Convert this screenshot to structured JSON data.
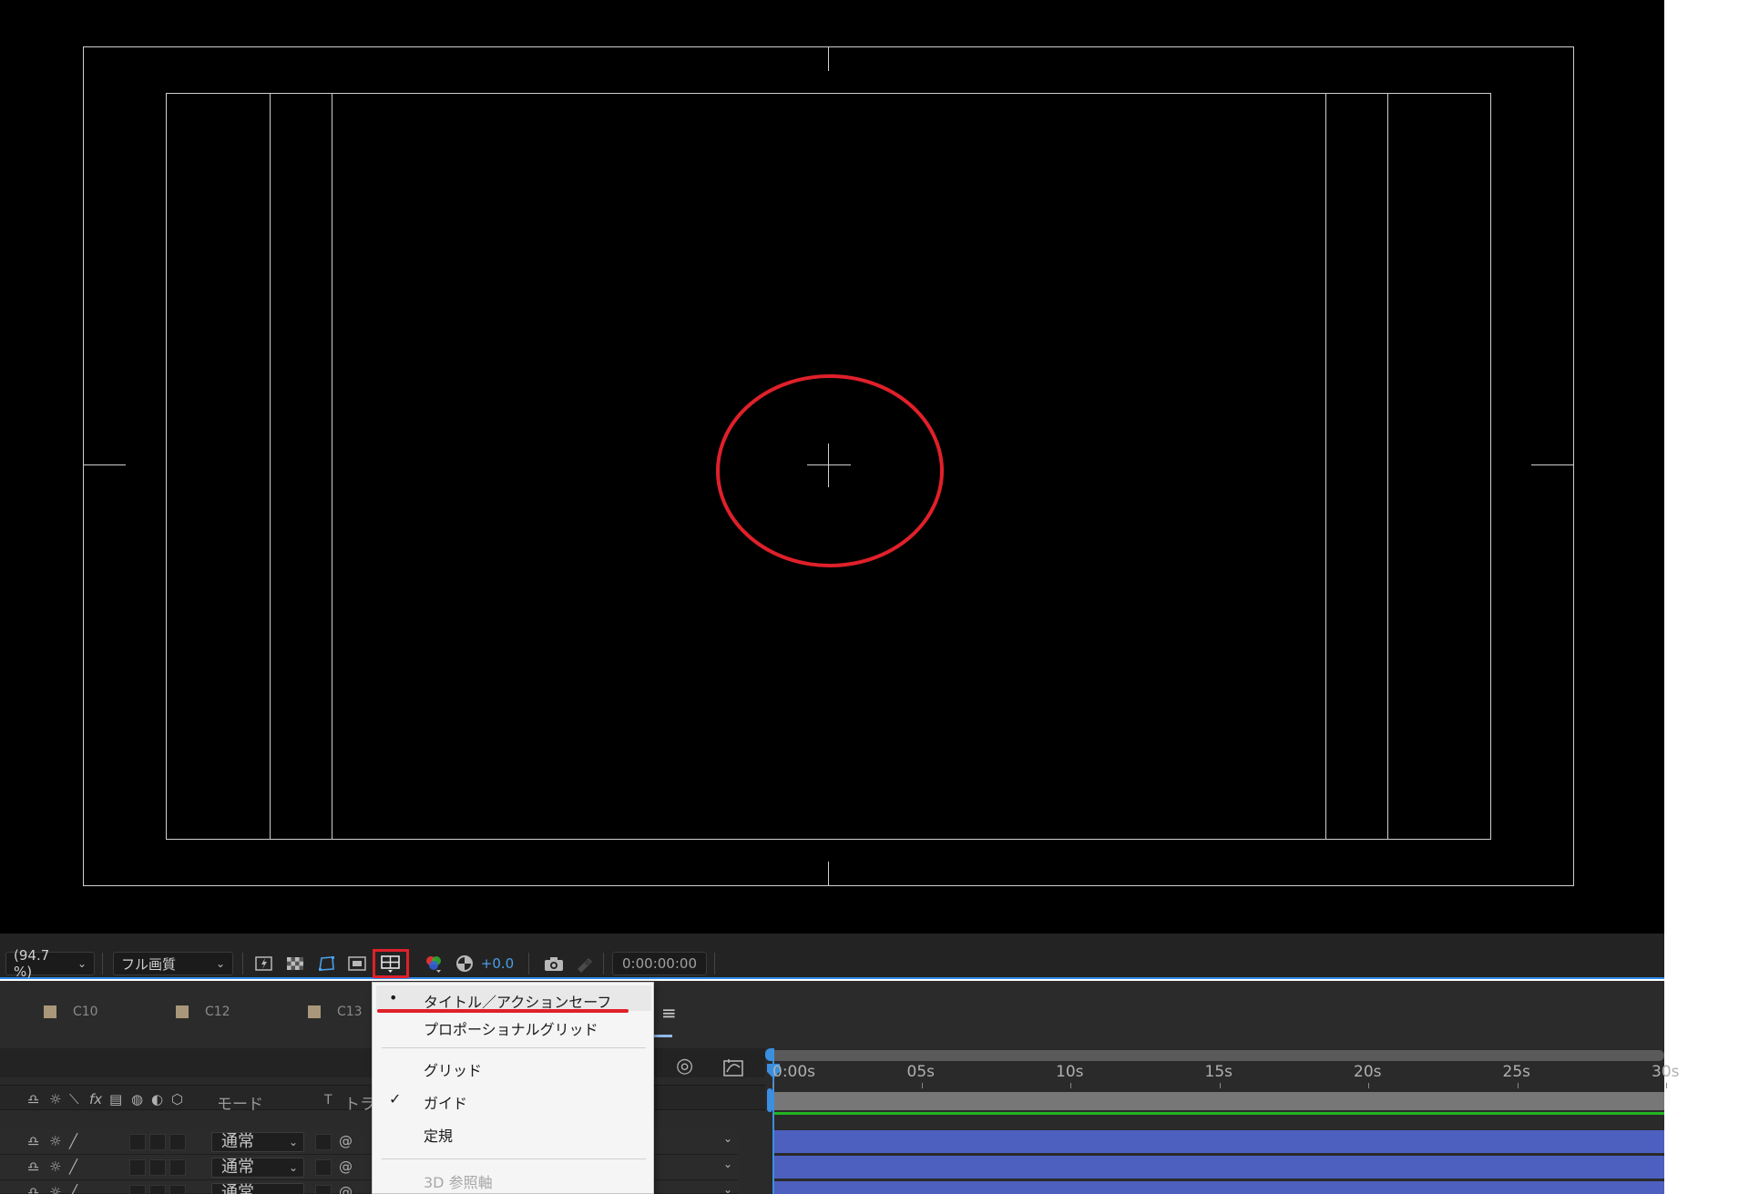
{
  "viewer": {
    "zoom_label": "(94.7 %)",
    "quality_label": "フル画質",
    "exposure_value": "+0.0",
    "timecode": "0:00:00:00"
  },
  "comp_tabs": [
    {
      "label": "C10"
    },
    {
      "label": "C12"
    },
    {
      "label": "C13"
    }
  ],
  "timeline": {
    "col_mode": "モード",
    "col_t": "T",
    "col_track": "トラ",
    "ruler_ticks": [
      "0:00s",
      "05s",
      "10s",
      "15s",
      "20s",
      "25s",
      "30s"
    ],
    "layers": [
      {
        "mode": "通常"
      },
      {
        "mode": "通常"
      },
      {
        "mode": "通常"
      }
    ]
  },
  "guide_menu": {
    "items": [
      {
        "label": "タイトル／アクションセーフ",
        "mark": "•",
        "enabled": true
      },
      {
        "label": "プロポーショナルグリッド",
        "mark": "",
        "enabled": true
      },
      {
        "label": "グリッド",
        "mark": "",
        "enabled": true
      },
      {
        "label": "ガイド",
        "mark": "✓",
        "enabled": true
      },
      {
        "label": "定規",
        "mark": "",
        "enabled": true
      },
      {
        "label": "3D 参照軸",
        "mark": "",
        "enabled": false
      }
    ]
  },
  "colors": {
    "highlight_red": "#e0202a",
    "accent_blue": "#3a8fe0",
    "layer_bar": "#4e60bf",
    "label_swatch": "#a9977a"
  }
}
